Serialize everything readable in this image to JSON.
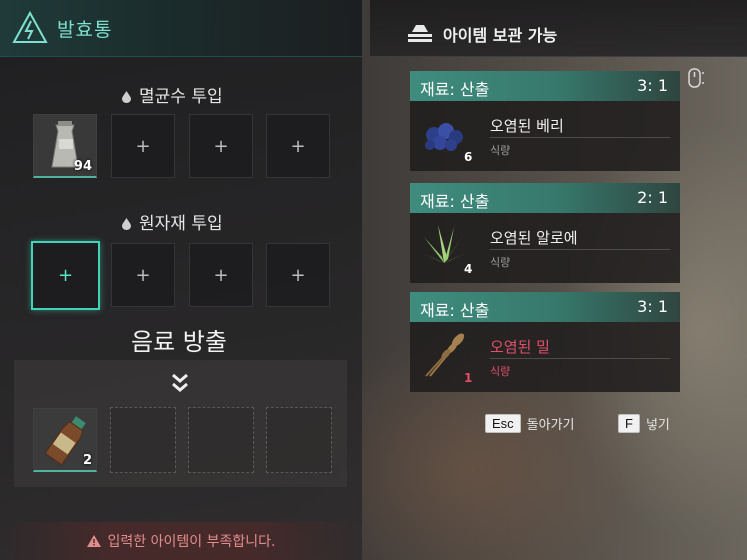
{
  "left_panel": {
    "title": "발효통",
    "sterile_water_label": "멸균수 투입",
    "raw_material_label": "원자재 투입",
    "output_label": "음료 방출",
    "slot_plus": "+",
    "sterile_item_count": "94",
    "output_item_count": "2",
    "warning": "입력한 아이템이 부족합니다."
  },
  "right_panel": {
    "title": "아이템 보관 가능",
    "items": [
      {
        "source": "재료: 산출",
        "ratio": "3: 1",
        "name": "오염된 베리",
        "category": "식량",
        "count": "6",
        "icon": "berries-icon",
        "insufficient": false
      },
      {
        "source": "재료: 산출",
        "ratio": "2: 1",
        "name": "오염된 알로에",
        "category": "식량",
        "count": "4",
        "icon": "aloe-icon",
        "insufficient": false
      },
      {
        "source": "재료: 산출",
        "ratio": "3: 1",
        "name": "오염된 밀",
        "category": "식량",
        "count": "1",
        "icon": "wheat-icon",
        "insufficient": true
      }
    ]
  },
  "hints": {
    "back_key": "Esc",
    "back_label": "돌아가기",
    "put_key": "F",
    "put_label": "넣기"
  },
  "colors": {
    "accent": "#3fd3b8",
    "card_header": "#3f8d7f",
    "warning": "#e28d8d",
    "insufficient": "#e0506a"
  }
}
